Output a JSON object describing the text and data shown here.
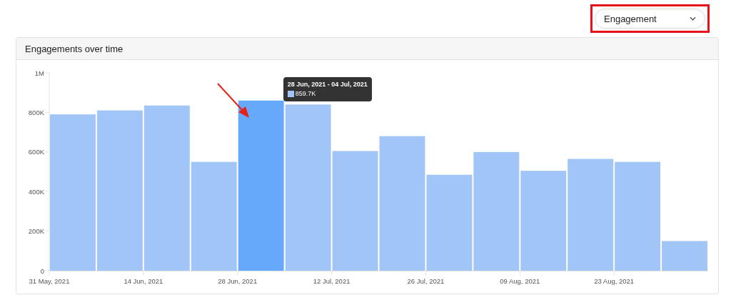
{
  "metric_dropdown": {
    "value": "Engagement"
  },
  "card": {
    "title": "Engagements over time",
    "tooltip": {
      "title": "28 Jun, 2021 - 04 Jul, 2021",
      "value": "859.7K"
    },
    "chart_data": {
      "type": "bar",
      "categories": [
        "31 May, 2021",
        null,
        "14 Jun, 2021",
        null,
        "28 Jun, 2021",
        null,
        "12 Jul, 2021",
        null,
        "26 Jul, 2021",
        null,
        "09 Aug, 2021",
        null,
        "23 Aug, 2021",
        null
      ],
      "stacked": true,
      "series": [
        {
          "color": "#a2c5f7",
          "values": [
            790000,
            810000,
            835000,
            550000,
            null,
            840000,
            605000,
            680000,
            485000,
            600000,
            505000,
            565000,
            550000,
            150000
          ]
        },
        {
          "color": "#66a9fb",
          "values": [
            null,
            null,
            null,
            null,
            860000,
            null,
            null,
            null,
            null,
            null,
            null,
            null,
            null,
            null
          ]
        }
      ],
      "ylim": [
        0,
        1000000
      ],
      "yticks": [
        {
          "value": 0,
          "label": "0"
        },
        {
          "value": 200000,
          "label": "200K"
        },
        {
          "value": 400000,
          "label": "400K"
        },
        {
          "value": 600000,
          "label": "600K"
        },
        {
          "value": 800000,
          "label": "800K"
        },
        {
          "value": 1000000,
          "label": "1M"
        }
      ]
    }
  }
}
